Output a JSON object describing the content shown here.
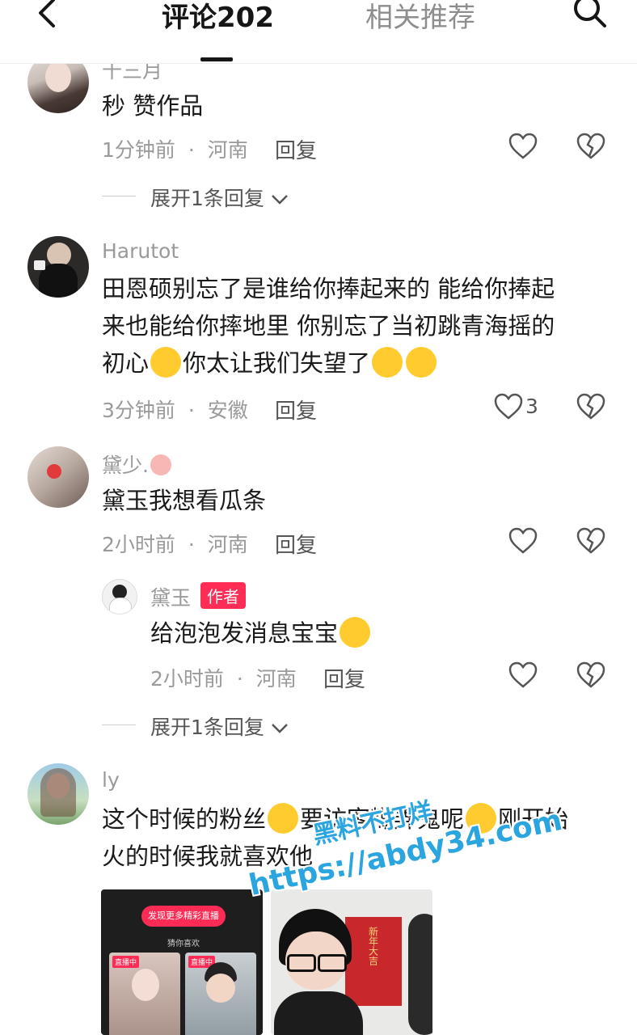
{
  "header": {
    "back_icon": "chevron-left-icon",
    "tab_comments": "评论202",
    "tab_related": "相关推荐",
    "search_icon": "search-icon"
  },
  "comments": [
    {
      "username": "十三月",
      "text": "秒 赞作品",
      "time": "1分钟前",
      "location": "河南",
      "reply_label": "回复",
      "expand_label": "展开1条回复"
    },
    {
      "username": "Harutot",
      "text_lines": [
        "田恩硕别忘了是谁给你捧起来的 能给你捧起",
        "来也能给你摔地里 你别忘了当初跳青海摇的",
        "初心",
        "你太让我们失望了"
      ],
      "time": "3分钟前",
      "location": "安徽",
      "reply_label": "回复",
      "like_count": "3"
    },
    {
      "username": "黛少.",
      "text": "黛玉我想看瓜条",
      "time": "2小时前",
      "location": "河南",
      "reply_label": "回复",
      "reply": {
        "username": "黛玉",
        "badge": "作者",
        "text": "给泡泡发消息宝宝",
        "time": "2小时前",
        "location": "河南",
        "reply_label": "回复"
      },
      "expand_label": "展开1条回复"
    },
    {
      "username": "ly",
      "text_line1a": "这个时候的粉丝",
      "text_line1b": "要访客糊弄鬼呢",
      "text_line1c": "刚开始",
      "text_line2": "火的时候我就喜欢他",
      "thumb1_button": "发现更多精彩直播",
      "thumb1_label": "猜你喜欢",
      "thumb1_live": "直播中",
      "thumb2_text": "新年大吉"
    }
  ],
  "watermark": {
    "line1": "黑料不打烊",
    "line2": "https://abdy34.com"
  },
  "separator": "·"
}
